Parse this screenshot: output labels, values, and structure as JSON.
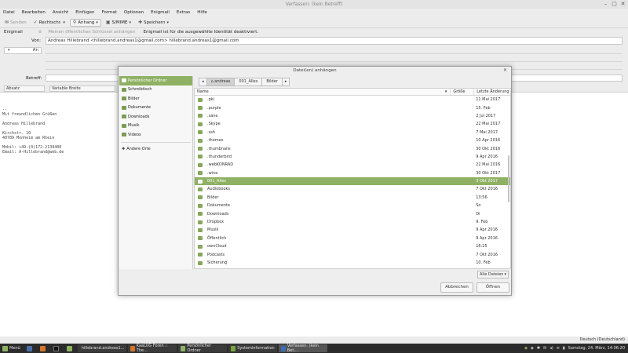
{
  "window": {
    "title": "Verfassen: (kein Betreff)"
  },
  "menu": [
    "Datei",
    "Bearbeiten",
    "Ansicht",
    "Einfügen",
    "Format",
    "Optionen",
    "Enigmail",
    "Extras",
    "Hilfe"
  ],
  "toolbar": {
    "send": "Senden",
    "spell": "Rechtschr.",
    "attach": "Anhang",
    "smime": "S/MIME",
    "save": "Speichern"
  },
  "enigmail": {
    "label": "Enigmail",
    "attach_key": "Meinen öffentlichen Schlüssel anhängen",
    "notice": "Enigmail ist für die ausgewählte Identität deaktiviert."
  },
  "header": {
    "from_label": "Von:",
    "from_value": "Andreas Hillebrand <hillebrand.andreas1@gmail.com>  hillebrand.andreas1@gmail.com",
    "to_label": "An",
    "subject_label": "Betreff:",
    "format_para": "Absatz",
    "format_width": "Variable Breite"
  },
  "body": "--\nMit freundlichen Grüßen\n\nAndreas Hillebrand\n\nKirchstr. 10\n40789 Monheim am Rhein\n\nMobil: +49-(0)172-2139400\nEmail: A-Hillebrand@web.de",
  "status": {
    "language": "Deutsch (Deutschland)"
  },
  "dialog": {
    "title": "Datei(en) anhängen",
    "places": [
      "Persönlicher Ordner",
      "Schreibtisch",
      "Bilder",
      "Dokumente",
      "Downloads",
      "Musik",
      "Videos"
    ],
    "other": "Andere Orte",
    "path": [
      "andreas",
      "001_Alles",
      "Bilder"
    ],
    "columns": {
      "name": "Name",
      "size": "Größe",
      "date": "Letzte Änderung"
    },
    "files": [
      {
        "name": ".pki",
        "date": "11 Mai 2017"
      },
      {
        "name": ".purple",
        "date": "15. Feb"
      },
      {
        "name": ".sane",
        "date": "2 Jul 2017"
      },
      {
        "name": ".Skype",
        "date": "22 Mai 2017"
      },
      {
        "name": ".ssh",
        "date": "7 Mai 2017"
      },
      {
        "name": ".themes",
        "date": "10 Apr 2016"
      },
      {
        "name": ".thumbnails",
        "date": "30 Okt 2016"
      },
      {
        "name": ".thunderbird",
        "date": "9 Apr 2016"
      },
      {
        "name": ".webKONRAD",
        "date": "22 Mai 2016"
      },
      {
        "name": ".wine",
        "date": "30 Okt 2017"
      },
      {
        "name": "001_Alles",
        "date": "3 Okt 2017"
      },
      {
        "name": "Audiobooks",
        "date": "7 Okt 2016"
      },
      {
        "name": "Bilder",
        "date": "13:56"
      },
      {
        "name": "Dokumente",
        "date": "So"
      },
      {
        "name": "Downloads",
        "date": "Di"
      },
      {
        "name": "Dropbox",
        "date": "9. Feb"
      },
      {
        "name": "Musik",
        "date": "9 Apr 2016"
      },
      {
        "name": "Öffentlich",
        "date": "9 Apr 2016"
      },
      {
        "name": "ownCloud",
        "date": "16:25"
      },
      {
        "name": "Podcasts",
        "date": "7 Okt 2016"
      },
      {
        "name": "Sicherung",
        "date": "10. Feb"
      }
    ],
    "selected_file": "001_Alles",
    "filter": "Alle Dateien",
    "cancel": "Abbrechen",
    "open": "Öffnen"
  },
  "taskbar": {
    "menu": "Menü",
    "tasks": [
      "hillebrand.andreas1...",
      "KaaLUG Foren :: The...",
      "Persönlicher Ordner",
      "Systeminformation",
      "Verfassen: (kein Bet..."
    ],
    "clock": "Samstag, 24. März, 14:06:20"
  },
  "colors": {
    "accent": "#8fb163",
    "taskbar": "#2b2b2b"
  }
}
